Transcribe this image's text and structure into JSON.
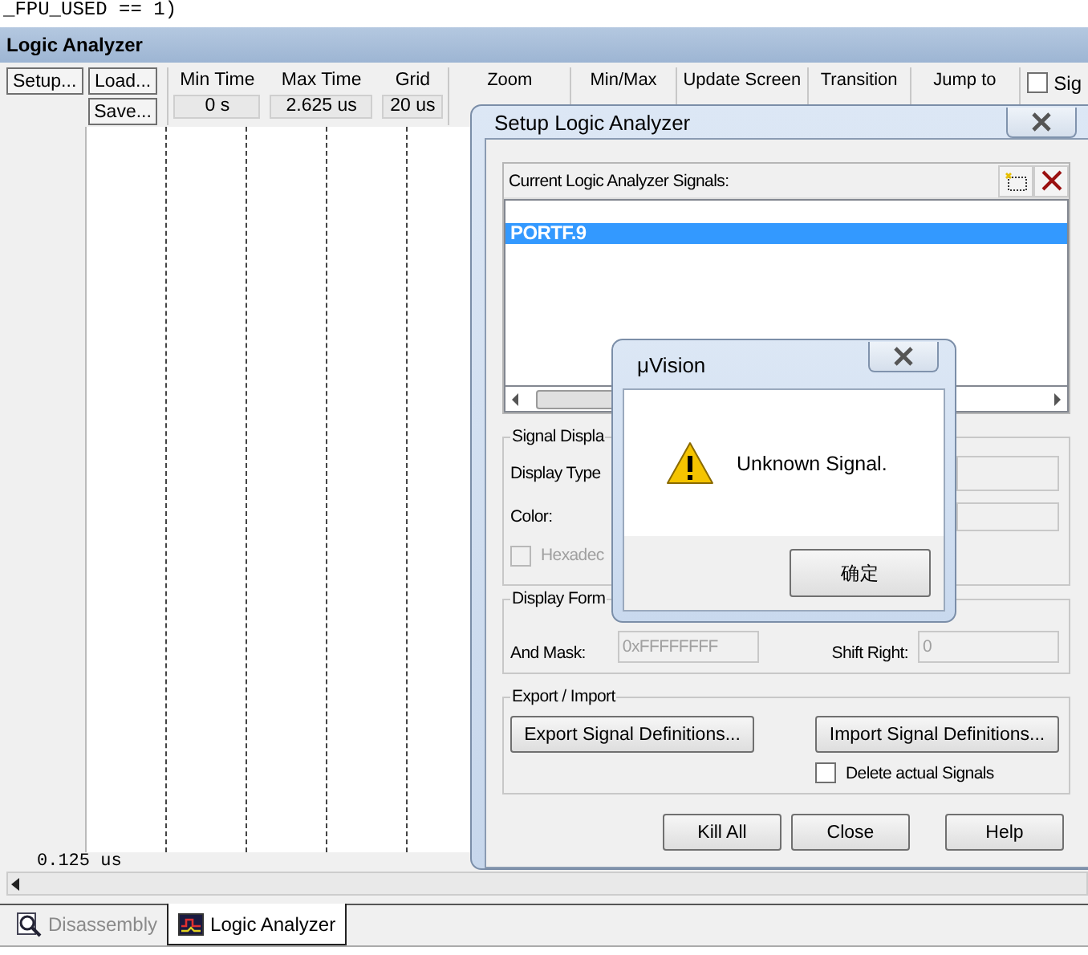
{
  "editor": {
    "code_line": "_FPU_USED == 1)"
  },
  "analyzer": {
    "title": "Logic Analyzer",
    "buttons": [
      {
        "label": "Setup..."
      },
      {
        "label": "Load..."
      },
      {
        "label": "Save..."
      }
    ],
    "readouts": [
      {
        "label": "Min Time",
        "value": "0 s"
      },
      {
        "label": "Max Time",
        "value": "2.625 us"
      },
      {
        "label": "Grid",
        "value": "20 us"
      }
    ],
    "groups": [
      "Zoom",
      "Min/Max",
      "Update Screen",
      "Transition",
      "Jump to"
    ],
    "signal_option": {
      "label": "Sig",
      "checked": false
    },
    "time_start": "0.125 us"
  },
  "setup": {
    "title": "Setup Logic Analyzer",
    "signals_label": "Current Logic Analyzer Signals:",
    "signals": [
      {
        "name": "PORTF.9",
        "selected": true
      }
    ],
    "display": {
      "title": "Signal Displa",
      "type_label": "Display Type",
      "color_label": "Color:",
      "hex": {
        "label": "Hexadec",
        "checked": false,
        "disabled": true
      }
    },
    "format": {
      "title": "Display Form",
      "mask_label": "And Mask:",
      "mask_value": "0xFFFFFFFF",
      "shift_label": "Shift Right:",
      "shift_value": "0"
    },
    "export": {
      "title": "Export / Import",
      "export_button": "Export Signal Definitions...",
      "import_button": "Import Signal Definitions...",
      "delete": {
        "label": "Delete actual Signals",
        "checked": false
      }
    },
    "buttons": [
      "Kill All",
      "Close",
      "Help"
    ]
  },
  "message": {
    "title": "μVision",
    "text": "Unknown Signal.",
    "button": "确定"
  },
  "tabs": [
    {
      "label": "Disassembly",
      "selected": false
    },
    {
      "label": "Logic Analyzer",
      "selected": true
    }
  ]
}
